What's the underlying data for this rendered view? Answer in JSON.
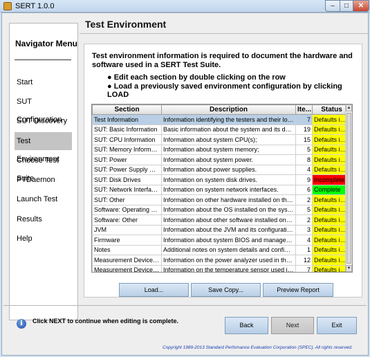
{
  "window": {
    "title": "SERT 1.0.0",
    "min": "–",
    "max": "□",
    "close": "✕"
  },
  "nav": {
    "title": "Navigator Menu",
    "items": [
      {
        "label": "Start"
      },
      {
        "label": "SUT Configuration"
      },
      {
        "label": "SUT Discovery"
      },
      {
        "label": "Test Environment",
        "active": true
      },
      {
        "label": "Choose Test Suite"
      },
      {
        "label": "PTDaemon"
      },
      {
        "label": "Launch Test"
      },
      {
        "label": "Results"
      },
      {
        "label": "Help"
      }
    ]
  },
  "page": {
    "title": "Test Environment",
    "intro": "Test environment information is required to document the hardware and software used in a SERT Test Suite.",
    "bullets": [
      "● Edit each section by double clicking on the row",
      "● Load a previously saved environment configuration by clicking LOAD"
    ]
  },
  "table": {
    "headers": [
      "Section",
      "Description",
      "Ite...",
      "Status"
    ],
    "rows": [
      {
        "section": "Test Information",
        "description": "Information identifying the testers and their location.",
        "items": "7",
        "status": "Defaults in use",
        "selected": true
      },
      {
        "section": "SUT: Basic Information",
        "description": "Basic information about the system and its devices.",
        "items": "19",
        "status": "Defaults in use"
      },
      {
        "section": "SUT: CPU Information",
        "description": "Information about system CPU(s);",
        "items": "15",
        "status": "Defaults in use"
      },
      {
        "section": "SUT: Memory Information",
        "description": "Information about system memory;",
        "items": "5",
        "status": "Defaults in use"
      },
      {
        "section": "SUT: Power",
        "description": "Information about system power.",
        "items": "8",
        "status": "Defaults in use"
      },
      {
        "section": "SUT: Power Supply Details",
        "description": "Information about power supplies.",
        "items": "4",
        "status": "Defaults in use"
      },
      {
        "section": "SUT: Disk Drives",
        "description": "Information on system disk drives.",
        "items": "9",
        "status": "Incomplete"
      },
      {
        "section": "SUT: Network Interfaces",
        "description": "Information on system network interfaces.",
        "items": "6",
        "status": "Complete"
      },
      {
        "section": "SUT: Other",
        "description": "Information on other hardware installed on the system.",
        "items": "2",
        "status": "Defaults in use"
      },
      {
        "section": "Software: Operating System",
        "description": "Information about the OS installed on the system.",
        "items": "5",
        "status": "Defaults in use"
      },
      {
        "section": "Software: Other",
        "description": "Information about other software installed on the syst...",
        "items": "2",
        "status": "Defaults in use"
      },
      {
        "section": "JVM",
        "description": "Information about the JVM and its configuration.",
        "items": "3",
        "status": "Defaults in use"
      },
      {
        "section": "Firmware",
        "description": "Information about system BIOS and management firm...",
        "items": "4",
        "status": "Defaults in use"
      },
      {
        "section": "Notes",
        "description": "Additional notes on system details and configuration.",
        "items": "1",
        "status": "Defaults in use"
      },
      {
        "section": "Measurement Device: Pow...",
        "description": "Information on the power analyzer used in the test.",
        "items": "12",
        "status": "Defaults in use"
      },
      {
        "section": "Measurement Device: Tem...",
        "description": "Information on the temperature sensor used in the test.",
        "items": "7",
        "status": "Defaults in use"
      }
    ]
  },
  "status_colors": {
    "Defaults in use": "#ffff00",
    "Incomplete": "#ff0000",
    "Complete": "#00ff00"
  },
  "actions": {
    "load": "Load...",
    "save": "Save Copy...",
    "preview": "Preview Report"
  },
  "footer": {
    "info": "Click NEXT to continue when editing is complete.",
    "back": "Back",
    "next": "Next",
    "exit": "Exit",
    "copyright": "Copyright 1989-2013 Standard Perfomance Evaluation Corporation (SPEC). All rights reserved."
  }
}
